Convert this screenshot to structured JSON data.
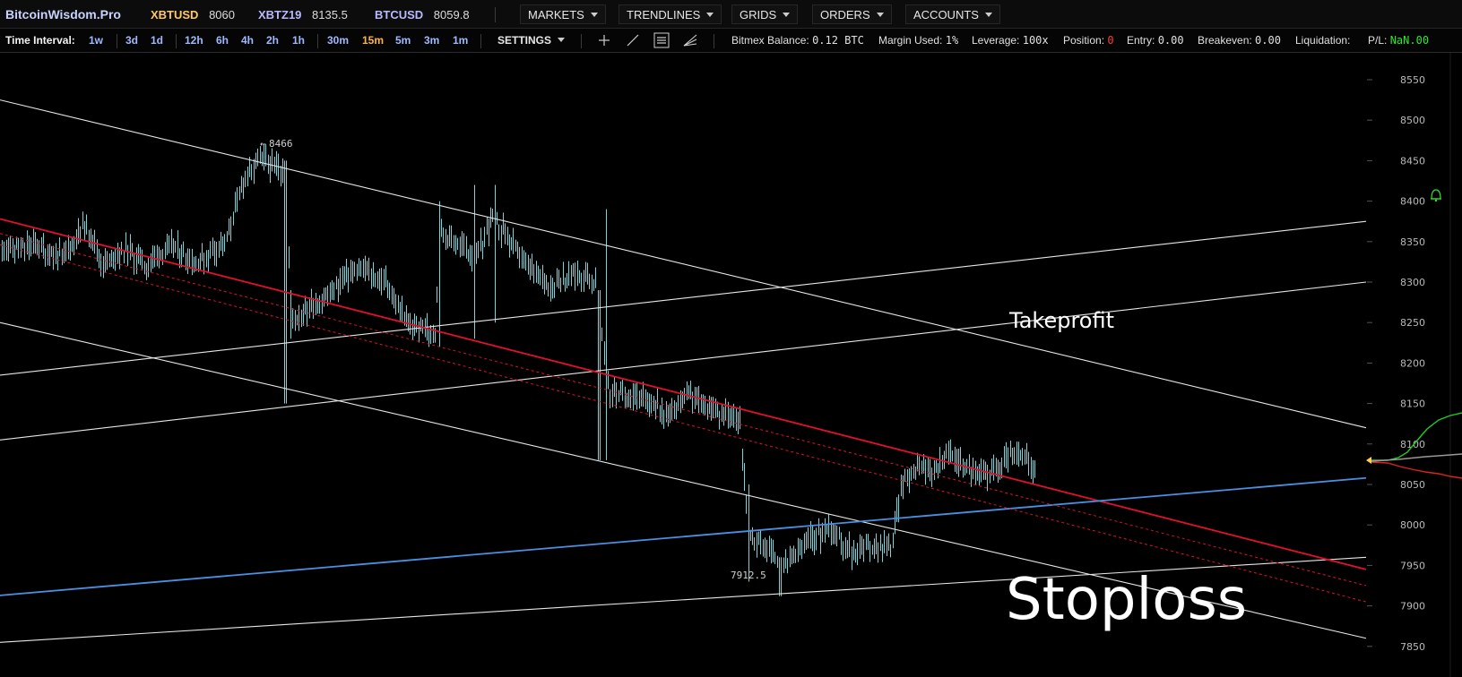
{
  "brand": "BitcoinWisdom.Pro",
  "tickers": [
    {
      "symbol": "XBTUSD",
      "price": "8060",
      "color": "#ffc766"
    },
    {
      "symbol": "XBTZ19",
      "price": "8135.5",
      "color": "#b9b9ff"
    },
    {
      "symbol": "BTCUSD",
      "price": "8059.8",
      "color": "#b9b9ff"
    }
  ],
  "menus": [
    "MARKETS",
    "TRENDLINES",
    "GRIDS",
    "ORDERS",
    "ACCOUNTS"
  ],
  "toolbar": {
    "time_interval_label": "Time Interval:",
    "intervals": [
      "1w",
      "3d",
      "1d",
      "12h",
      "6h",
      "4h",
      "2h",
      "1h",
      "30m",
      "15m",
      "5m",
      "3m",
      "1m"
    ],
    "active_interval": "15m",
    "settings_label": "SETTINGS"
  },
  "account": {
    "balance_label": "Bitmex Balance:",
    "balance_value": "0.12 BTC",
    "margin_label": "Margin Used:",
    "margin_value": "1%",
    "leverage_label": "Leverage:",
    "leverage_value": "100x",
    "position_label": "Position:",
    "position_value": "0",
    "entry_label": "Entry:",
    "entry_value": "0.00",
    "breakeven_label": "Breakeven:",
    "breakeven_value": "0.00",
    "liquidation_label": "Liquidation:",
    "liquidation_value": "",
    "pl_label": "P/L:",
    "pl_value": "NaN.00"
  },
  "chart_data": {
    "type": "candlestick",
    "price_axis": [
      "8550",
      "8500",
      "8450",
      "8400",
      "8350",
      "8300",
      "8250",
      "8200",
      "8150",
      "8100",
      "8050",
      "8000",
      "7950",
      "7900",
      "7850"
    ],
    "high_label": "8466",
    "low_label": "7912.5",
    "annotations": [
      "Takeprofit",
      "Stoploss"
    ],
    "colors": {
      "candles": "#7fd3d8",
      "trendlines": "#e6e6e6",
      "red_line": "#e0102e",
      "blue_line": "#4a90e2",
      "depth_green": "#22cc22",
      "depth_red": "#dd2222"
    },
    "trendlines": [
      {
        "color": "white",
        "from": [
          0,
          8525
        ],
        "to": [
          1524,
          8120
        ]
      },
      {
        "color": "white",
        "from": [
          0,
          8250
        ],
        "to": [
          1524,
          7860
        ]
      },
      {
        "color": "white",
        "from": [
          0,
          8185
        ],
        "to": [
          1524,
          8375
        ]
      },
      {
        "color": "white",
        "from": [
          0,
          8105
        ],
        "to": [
          1524,
          8300
        ]
      },
      {
        "color": "white",
        "from": [
          0,
          7855
        ],
        "to": [
          1524,
          7960
        ]
      },
      {
        "color": "red",
        "from": [
          0,
          8378
        ],
        "to": [
          1524,
          7945
        ]
      },
      {
        "color": "blue",
        "from": [
          0,
          7913
        ],
        "to": [
          1524,
          8058
        ]
      }
    ]
  }
}
